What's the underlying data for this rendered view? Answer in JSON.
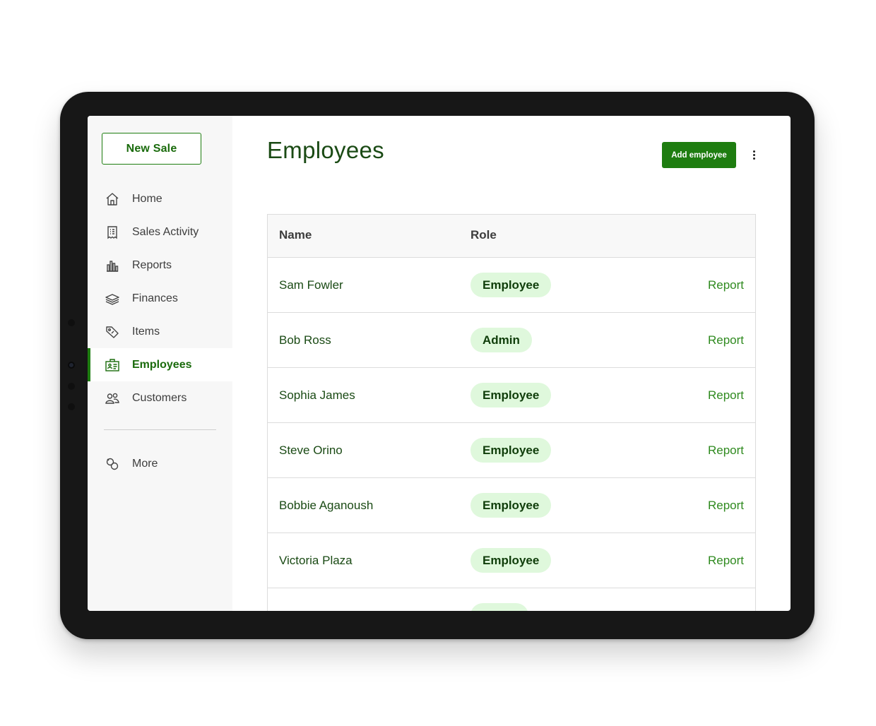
{
  "sidebar": {
    "new_sale_label": "New Sale",
    "items": [
      {
        "label": "Home",
        "icon": "home-icon"
      },
      {
        "label": "Sales Activity",
        "icon": "receipt-icon"
      },
      {
        "label": "Reports",
        "icon": "bar-chart-icon"
      },
      {
        "label": "Finances",
        "icon": "stack-icon"
      },
      {
        "label": "Items",
        "icon": "tag-icon"
      },
      {
        "label": "Employees",
        "icon": "id-badge-icon",
        "active": true
      },
      {
        "label": "Customers",
        "icon": "people-icon"
      }
    ],
    "more_label": "More",
    "more_icon": "circles-icon"
  },
  "header": {
    "title": "Employees",
    "add_button_label": "Add employee",
    "menu_icon": "kebab-icon"
  },
  "table": {
    "columns": [
      "Name",
      "Role"
    ],
    "rows": [
      {
        "name": "Sam Fowler",
        "role": "Employee",
        "action": "Report"
      },
      {
        "name": "Bob Ross",
        "role": "Admin",
        "action": "Report"
      },
      {
        "name": "Sophia James",
        "role": "Employee",
        "action": "Report"
      },
      {
        "name": "Steve Orino",
        "role": "Employee",
        "action": "Report"
      },
      {
        "name": "Bobbie Aganoush",
        "role": "Employee",
        "action": "Report"
      },
      {
        "name": "Victoria Plaza",
        "role": "Employee",
        "action": "Report"
      }
    ]
  },
  "colors": {
    "brand_green": "#1e7d10",
    "link_green": "#2f8a1f",
    "badge_bg": "#dff8dc",
    "frame": "#171717"
  }
}
